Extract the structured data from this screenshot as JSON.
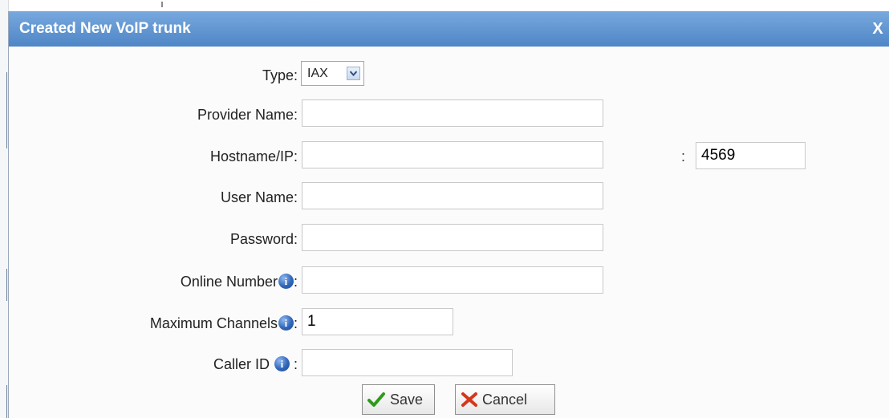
{
  "dialog": {
    "title": "Created New VoIP trunk",
    "close_label": "X"
  },
  "form": {
    "type": {
      "label": "Type:",
      "value": "IAX"
    },
    "provider_name": {
      "label": "Provider Name:",
      "value": ""
    },
    "hostname": {
      "label": "Hostname/IP:",
      "value": "",
      "port_separator": ":",
      "port": "4569"
    },
    "user_name": {
      "label": "User Name:",
      "value": ""
    },
    "password": {
      "label": "Password:",
      "value": ""
    },
    "online_number": {
      "label": "Online Number",
      "suffix": ":",
      "value": ""
    },
    "max_channels": {
      "label": "Maximum Channels",
      "suffix": ":",
      "value": "1"
    },
    "caller_id": {
      "label": "Caller ID ",
      "suffix": " :",
      "value": ""
    },
    "info_icon_glyph": "i"
  },
  "buttons": {
    "save": "Save",
    "cancel": "Cancel"
  },
  "colors": {
    "title_bar": "#5b90cf",
    "save_check": "#2e9b18",
    "cancel_x": "#d4371c"
  }
}
